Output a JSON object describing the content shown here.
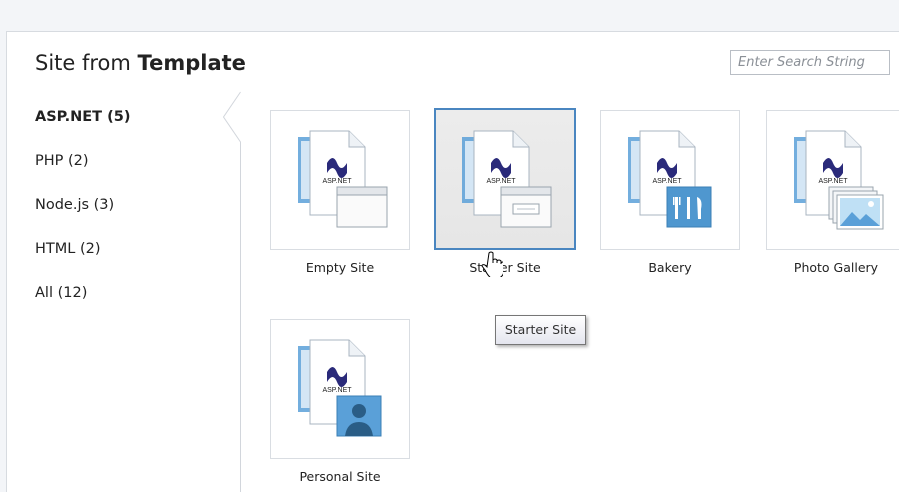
{
  "header": {
    "title_prefix": "Site from ",
    "title_bold": "Template",
    "search_placeholder": "Enter Search String"
  },
  "categories": [
    {
      "label": "ASP.NET (5)",
      "selected": true
    },
    {
      "label": "PHP (2)",
      "selected": false
    },
    {
      "label": "Node.js (3)",
      "selected": false
    },
    {
      "label": "HTML (2)",
      "selected": false
    },
    {
      "label": "All (12)",
      "selected": false
    }
  ],
  "templates": [
    {
      "label": "Empty Site",
      "badge": "window",
      "selected": false
    },
    {
      "label": "Starter Site",
      "badge": "form-window",
      "selected": true
    },
    {
      "label": "Bakery",
      "badge": "fork-knife",
      "selected": false
    },
    {
      "label": "Photo Gallery",
      "badge": "photos",
      "selected": false
    },
    {
      "label": "Personal Site",
      "badge": "person",
      "selected": false
    }
  ],
  "tile_logo_text": "ASP.NET",
  "tooltip": "Starter Site",
  "colors": {
    "selection_border": "#4a86c0",
    "accent_blue": "#5aa0d8"
  }
}
